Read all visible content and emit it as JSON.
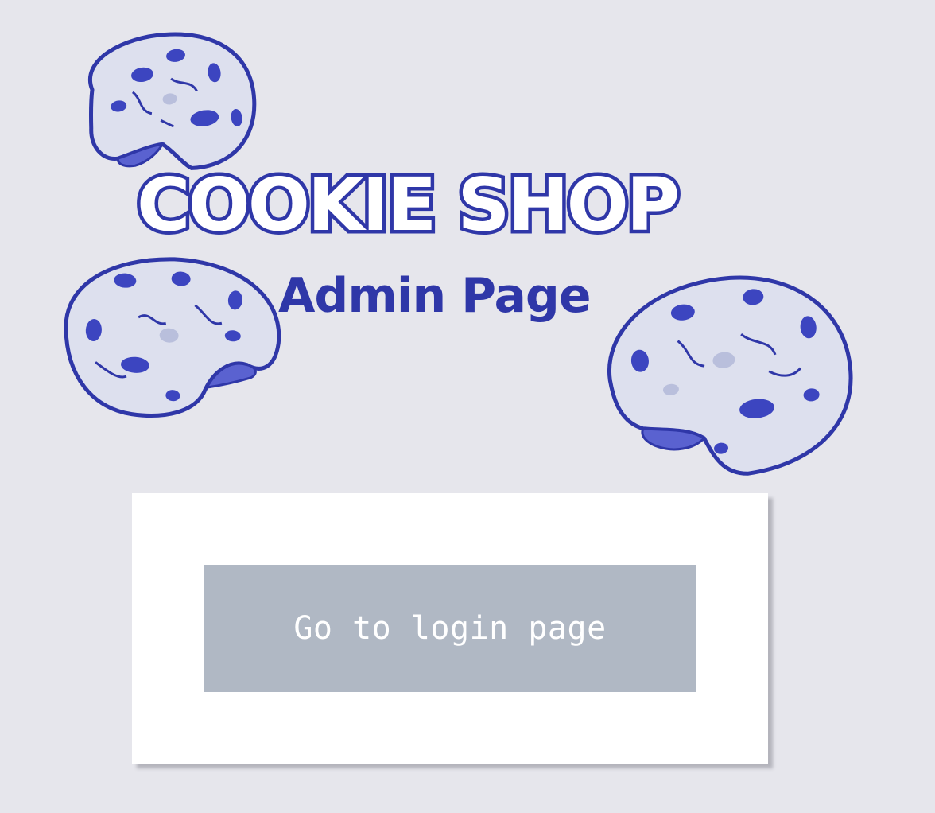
{
  "header": {
    "title": "COOKIE SHOP",
    "subtitle": "Admin Page"
  },
  "decorations": {
    "icon": "bitten-cookie-icon",
    "count": 3
  },
  "card": {
    "button_label": "Go to login page"
  },
  "colors": {
    "background": "#e6e6ec",
    "brand_blue": "#2f37a8",
    "cookie_fill": "#dde0ee",
    "card": "#ffffff",
    "button": "#b0b8c4",
    "button_text": "#ffffff"
  }
}
